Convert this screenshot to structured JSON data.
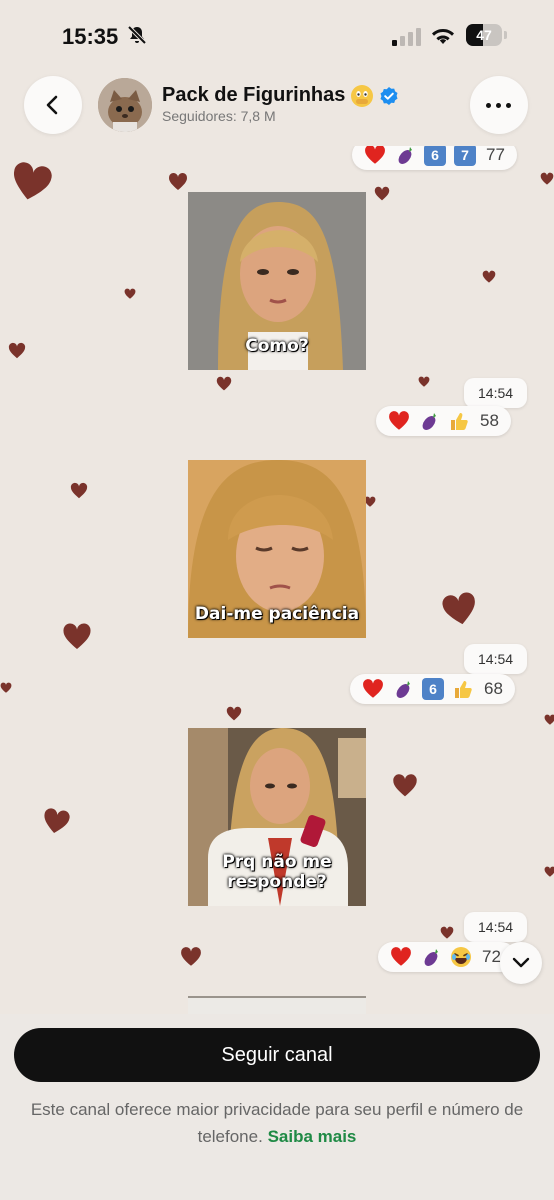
{
  "status_bar": {
    "time": "15:35",
    "battery": "47",
    "battery_level": 0.47
  },
  "header": {
    "title": "Pack de Figurinhas",
    "subtitle": "Seguidores: 7,8 M",
    "icons": [
      "back-chevron-icon",
      "avatar-cat",
      "face-with-hand-over-mouth-emoji",
      "verified-badge-icon",
      "more-options-icon"
    ]
  },
  "messages": [
    {
      "caption": "",
      "reactions": [
        "heart",
        "eggplant",
        "6",
        "7"
      ],
      "count": "77"
    },
    {
      "caption": "Como?",
      "time": "14:54",
      "reactions": [
        "heart",
        "eggplant",
        "thumbs-up"
      ],
      "count": "58"
    },
    {
      "caption": "Dai-me paciência",
      "time": "14:54",
      "reactions": [
        "heart",
        "eggplant",
        "6",
        "thumbs-up"
      ],
      "count": "68"
    },
    {
      "caption": "Prq não me responde?",
      "time": "14:54",
      "reactions": [
        "heart",
        "eggplant",
        "laughing"
      ],
      "count": "72"
    }
  ],
  "bottom": {
    "follow_label": "Seguir canal",
    "notice_text": "Este canal oferece maior privacidade para seu perfil e número de telefone.",
    "learn_more": "Saiba mais"
  },
  "colors": {
    "accent_link": "#1f8a45",
    "heart": "#7a332b",
    "follow_button": "#111111"
  }
}
